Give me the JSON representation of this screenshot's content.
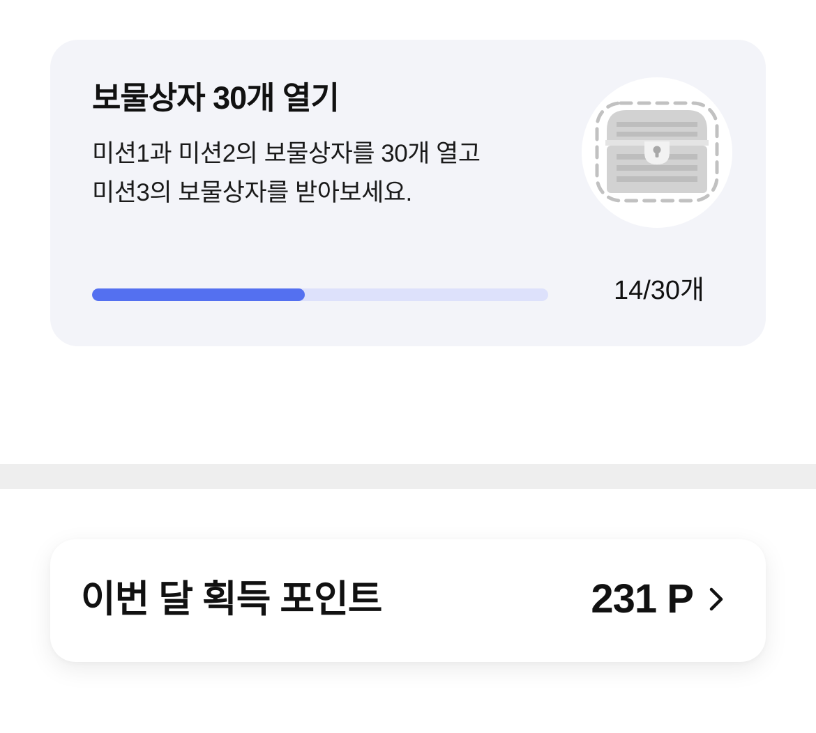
{
  "mission": {
    "title": "보물상자 30개 열기",
    "description_lines": [
      "미션1과 미션2의 보물상자를 30개 열고",
      "미션3의 보물상자를 받아보세요."
    ],
    "chest_icon": "locked-treasure-chest-icon",
    "progress": {
      "current": 14,
      "total": 30,
      "fraction": 0.4667,
      "text": "14/30개"
    }
  },
  "points": {
    "label": "이번 달 획득 포인트",
    "value": "231 P",
    "chevron_icon": "chevron-right-icon"
  },
  "colors": {
    "card_background": "#f3f4f9",
    "progress_fill": "#5470f0",
    "progress_track": "#dde1fb",
    "divider": "#eeeeee",
    "text_primary": "#111111"
  }
}
